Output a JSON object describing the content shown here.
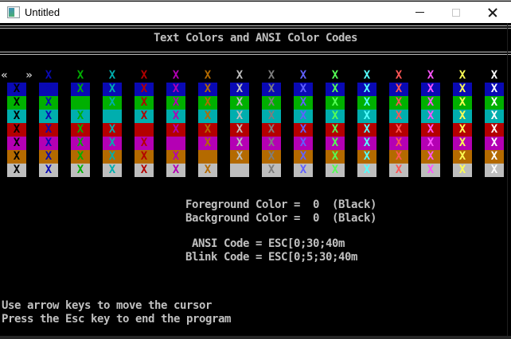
{
  "window": {
    "title": "Untitled",
    "icon": "console-app-icon",
    "controls": [
      {
        "name": "minimize",
        "enabled": true
      },
      {
        "name": "maximize",
        "enabled": false
      },
      {
        "name": "close",
        "enabled": true
      }
    ]
  },
  "screen": {
    "title": "Text Colors and ANSI Color Codes",
    "grid": {
      "cell_char": "X",
      "columns": 16,
      "background_rows": 8,
      "cursor": {
        "row": 0,
        "col": 0,
        "left_marker": "«",
        "right_marker": "»"
      },
      "palette": [
        {
          "name": "black",
          "hex": "#000000"
        },
        {
          "name": "blue",
          "hex": "#0909B4"
        },
        {
          "name": "green",
          "hex": "#00B000"
        },
        {
          "name": "cyan",
          "hex": "#00AEAE"
        },
        {
          "name": "red",
          "hex": "#B40000"
        },
        {
          "name": "magenta",
          "hex": "#B400B4"
        },
        {
          "name": "brown",
          "hex": "#B46A00"
        },
        {
          "name": "light-gray",
          "hex": "#BEBEBE"
        },
        {
          "name": "dark-gray",
          "hex": "#7E7E7E"
        },
        {
          "name": "bright-blue",
          "hex": "#6161FF"
        },
        {
          "name": "bright-green",
          "hex": "#55FF55"
        },
        {
          "name": "bright-cyan",
          "hex": "#55FFFF"
        },
        {
          "name": "bright-red",
          "hex": "#FF5555"
        },
        {
          "name": "bright-magenta",
          "hex": "#FF55FF"
        },
        {
          "name": "yellow",
          "hex": "#FFFF55"
        },
        {
          "name": "white",
          "hex": "#FFFFFF"
        }
      ]
    },
    "status": {
      "foreground_line": "Foreground Color =  0  (Black)",
      "background_line": "Background Color =  0  (Black)",
      "ansi_line": " ANSI Code = ESC[0;30;40m",
      "blink_line": "Blink Code = ESC[0;5;30;40m"
    },
    "help": {
      "line1": "Use arrow keys to move the cursor",
      "line2": "Press the Esc key to end the program"
    },
    "colors": {
      "text": "#C0C0C0",
      "background": "#000000"
    }
  }
}
